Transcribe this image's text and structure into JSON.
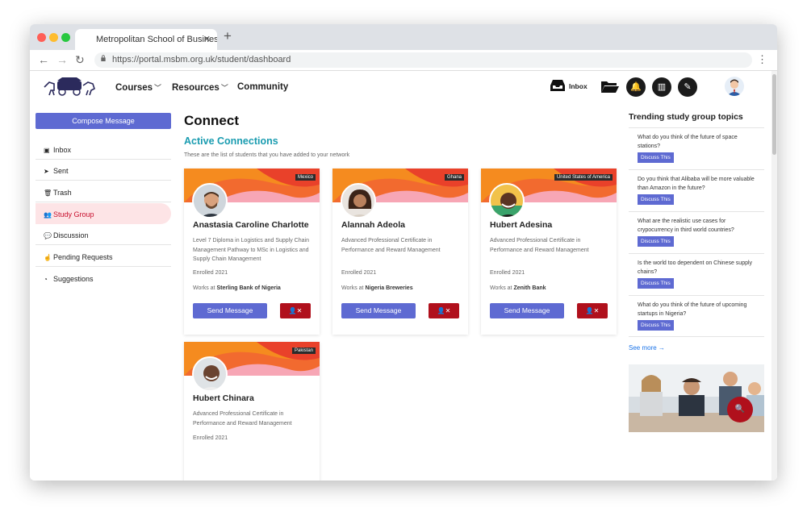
{
  "browser": {
    "tab_title": "Metropolitan School of Busines",
    "url": "https://portal.msbm.org.uk/student/dashboard"
  },
  "header": {
    "nav": [
      {
        "label": "Courses"
      },
      {
        "label": "Resources"
      },
      {
        "label": "Community"
      }
    ],
    "inbox_label": "Inbox"
  },
  "sidebar": {
    "compose_label": "Compose Message",
    "items": [
      {
        "label": "Inbox",
        "icon": "inbox-icon"
      },
      {
        "label": "Sent",
        "icon": "send-icon"
      },
      {
        "label": "Trash",
        "icon": "trash-icon"
      },
      {
        "label": "Study Group",
        "icon": "group-icon"
      },
      {
        "label": "Discussion",
        "icon": "discussion-icon"
      },
      {
        "label": "Pending Requests",
        "icon": "pending-icon"
      },
      {
        "label": "Suggestions",
        "icon": "suggestions-icon"
      }
    ]
  },
  "main": {
    "title": "Connect",
    "section_title": "Active Connections",
    "section_desc": "These are the list of students that you have added to your network",
    "cards": [
      {
        "name": "Anastasia Caroline Charlotte",
        "country": "Mexico",
        "program": "Level 7 Diploma in Logistics and Supply Chain Management Pathway to MSc in Logistics and Supply Chain Management",
        "enrolled": "Enrolled 2021",
        "works_prefix": "Works at",
        "employer": "Sterling Bank of Nigeria",
        "send_label": "Send Message"
      },
      {
        "name": "Alannah Adeola",
        "country": "Ghana",
        "program": "Advanced Professional Certificate in Performance and Reward Management",
        "enrolled": "Enrolled 2021",
        "works_prefix": "Works at",
        "employer": "Nigeria Breweries",
        "send_label": "Send Message"
      },
      {
        "name": "Hubert Adesina",
        "country": "United States of America",
        "program": "Advanced Professional Certificate in Performance and Reward Management",
        "enrolled": "Enrolled 2021",
        "works_prefix": "Works at",
        "employer": "Zenith Bank",
        "send_label": "Send Message"
      },
      {
        "name": "Hubert Chinara",
        "country": "Pakistan",
        "program": "Advanced Professional Certificate in Performance and Reward Management",
        "enrolled": "Enrolled 2021"
      }
    ]
  },
  "trending": {
    "title": "Trending study group topics",
    "topics": [
      {
        "question": "What do you think of the future of space stations?",
        "button": "Discuss This"
      },
      {
        "question": "Do you think that Alibaba will be more valuable than Amazon in the future?",
        "button": "Discuss This"
      },
      {
        "question": "What are the realistic use cases for crypocurrency in third world countries?",
        "button": "Discuss This"
      },
      {
        "question": "Is the world too dependent on Chinese supply chains?",
        "button": "Discuss This"
      },
      {
        "question": "What do you think of the future of upcoming startups in Nigeria?",
        "button": "Discuss This"
      }
    ],
    "see_more": "See more →"
  },
  "colors": {
    "primary": "#5e6ad2",
    "danger": "#b0101c",
    "teal": "#1a9cb0",
    "active_bg": "#fde4e6"
  }
}
